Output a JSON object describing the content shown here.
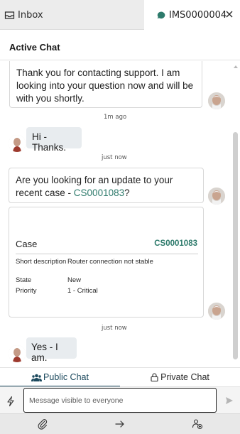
{
  "tabs": {
    "inbox_label": "Inbox",
    "active_label": "IMS0000004"
  },
  "header": {
    "title": "Active Chat"
  },
  "messages": {
    "agent_1": "Thank you for contacting support. I am looking into your question now and will be with you shortly.",
    "time_1": "1m ago",
    "user_1": "Hi -Thanks.",
    "time_2": "just now",
    "agent_2_prefix": "Are you looking for an update to your recent case - ",
    "agent_2_link": "CS0001083",
    "agent_2_suffix": "?",
    "time_3": "just now",
    "user_2": "Yes - I am."
  },
  "case_card": {
    "title": "Case",
    "number": "CS0001083",
    "rows": [
      {
        "label": "Short description",
        "value": "Router connection not stable"
      },
      {
        "label": "State",
        "value": "New"
      },
      {
        "label": "Priority",
        "value": "1 - Critical"
      }
    ]
  },
  "mode_tabs": {
    "public_label": "Public Chat",
    "private_label": "Private Chat",
    "selected": "Public Chat"
  },
  "composer": {
    "placeholder": "Message visible to everyone",
    "value": ""
  },
  "icons": {
    "inbox": "inbox-icon",
    "chat": "chat-bubble-icon",
    "close": "close-icon",
    "public": "people-icon",
    "private": "lock-icon",
    "quick_actions": "bolt-icon",
    "send": "send-icon",
    "attach": "paperclip-icon",
    "transfer": "arrow-right-icon",
    "add_user": "add-user-icon"
  },
  "colors": {
    "accent": "#2d7a6b",
    "selected_tab": "#1d4a5e",
    "user_bubble": "#e8ecef"
  }
}
